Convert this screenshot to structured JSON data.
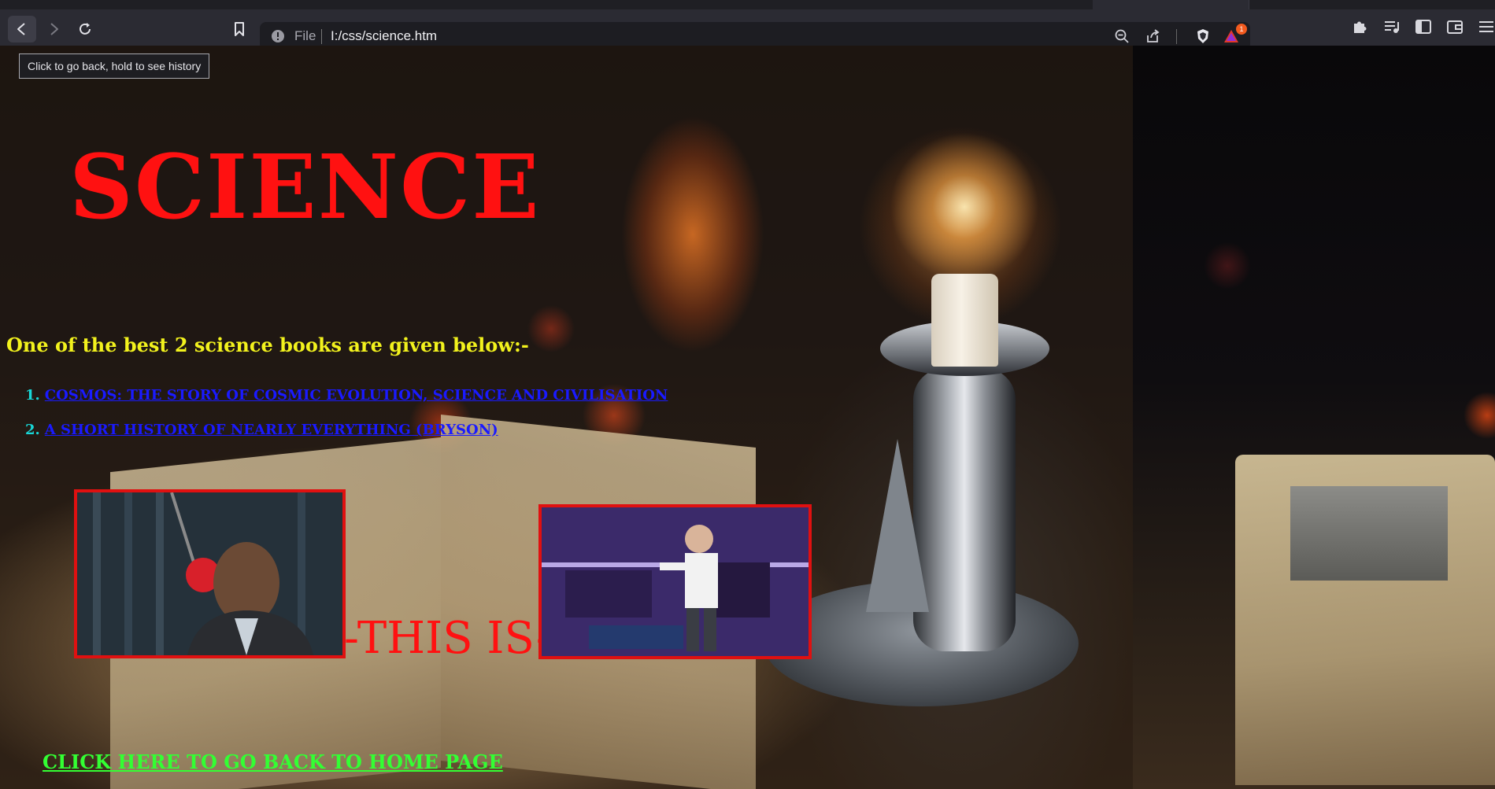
{
  "browser": {
    "back_tooltip": "Click to go back, hold to see history",
    "address_scheme": "File",
    "address_url": "I:/css/science.htm",
    "notification_badge": "1",
    "icons": {
      "back": "back-arrow-icon",
      "forward": "forward-arrow-icon",
      "reload": "reload-icon",
      "bookmark": "bookmark-icon",
      "site_info": "info-icon",
      "zoom": "zoom-out-icon",
      "share": "share-icon",
      "shields": "brave-shields-icon",
      "rewards": "brave-rewards-icon",
      "extensions": "puzzle-icon",
      "playlist": "playlist-icon",
      "sidebar": "sidebar-icon",
      "wallet": "wallet-icon",
      "menu": "menu-icon"
    }
  },
  "page": {
    "title": "SCIENCE",
    "intro": "One of the best 2 science books are given below:-",
    "books": [
      {
        "number": "1.",
        "title": "COSMOS: THE STORY OF COSMIC EVOLUTION, SCIENCE AND CIVILISATION"
      },
      {
        "number": "2.",
        "title": "A SHORT HISTORY OF NEARLY EVERYTHING (BRYSON)"
      }
    ],
    "this_is": "-THIS IS-",
    "home_link": "CLICK HERE TO GO BACK TO HOME PAGE"
  },
  "colors": {
    "title": "#ff1111",
    "intro": "#f2f21d",
    "list_number": "#18d8d8",
    "book_link": "#1a1aff",
    "home_link": "#33ff33",
    "image_border": "#e01010"
  }
}
